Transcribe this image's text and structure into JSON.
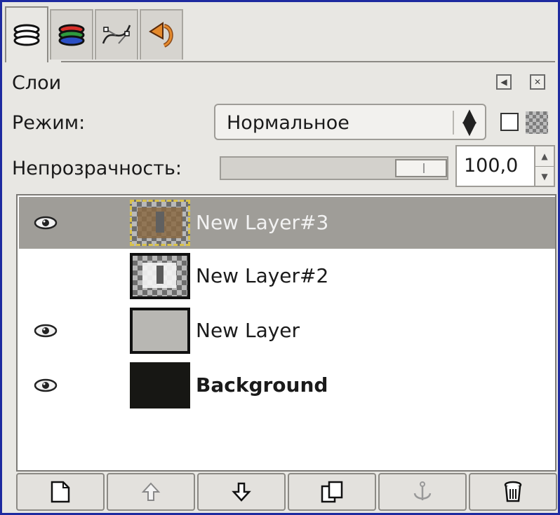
{
  "tabs": [
    {
      "icon": "layers-icon",
      "active": true
    },
    {
      "icon": "channels-icon",
      "active": false
    },
    {
      "icon": "paths-icon",
      "active": false
    },
    {
      "icon": "undo-history-icon",
      "active": false
    }
  ],
  "panel": {
    "title": "Слои"
  },
  "mode": {
    "label": "Режим:",
    "value": "Нормальное"
  },
  "opacity": {
    "label": "Непрозрачность:",
    "value": "100,0",
    "level_percent": 100
  },
  "layers": [
    {
      "name": "New Layer#3",
      "visible": true,
      "selected": true,
      "bold": false
    },
    {
      "name": "New Layer#2",
      "visible": false,
      "selected": false,
      "bold": false
    },
    {
      "name": "New Layer",
      "visible": true,
      "selected": false,
      "bold": false
    },
    {
      "name": "Background",
      "visible": true,
      "selected": false,
      "bold": true
    }
  ],
  "bottom_buttons": [
    {
      "icon": "new-layer-icon"
    },
    {
      "icon": "raise-layer-icon"
    },
    {
      "icon": "lower-layer-icon"
    },
    {
      "icon": "duplicate-layer-icon"
    },
    {
      "icon": "anchor-layer-icon"
    },
    {
      "icon": "delete-layer-icon"
    }
  ],
  "colors": {
    "selection": "#9f9d98",
    "frame": "#1e2aa0",
    "panel_bg": "#e8e7e3"
  }
}
